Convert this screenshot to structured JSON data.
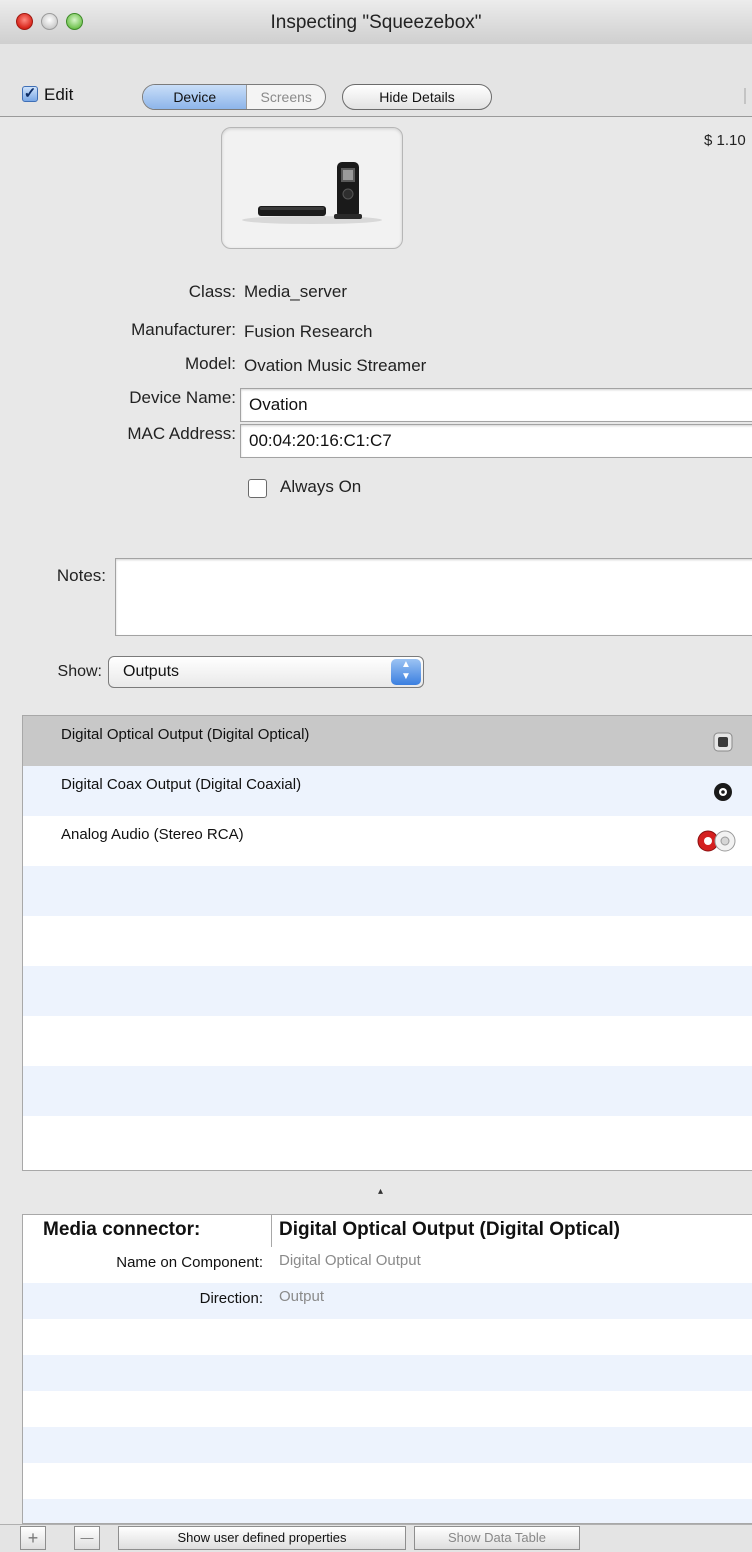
{
  "window": {
    "title": "Inspecting \"Squeezebox\""
  },
  "toolbar": {
    "edit_label": "Edit",
    "edit_checked": true,
    "segments": [
      "Device",
      "Screens"
    ],
    "selected_segment": "Device",
    "hide_details_label": "Hide Details"
  },
  "price": "$ 1.10",
  "device": {
    "class_label": "Class:",
    "class_value": "Media_server",
    "manufacturer_label": "Manufacturer:",
    "manufacturer_value": "Fusion Research",
    "model_label": "Model:",
    "model_value": "Ovation Music Streamer",
    "device_name_label": "Device Name:",
    "device_name_value": "Ovation",
    "mac_label": "MAC Address:",
    "mac_value": "00:04:20:16:C1:C7",
    "always_on_label": "Always On",
    "always_on_checked": false,
    "notes_label": "Notes:",
    "notes_value": ""
  },
  "show": {
    "label": "Show:",
    "selected": "Outputs"
  },
  "outputs": [
    {
      "label": "Digital Optical Output (Digital Optical)",
      "connector": "optical-connector-icon",
      "selected": true
    },
    {
      "label": "Digital Coax Output (Digital Coaxial)",
      "connector": "coax-connector-icon",
      "selected": false
    },
    {
      "label": "Analog Audio (Stereo RCA)",
      "connector": "rca-stereo-connector-icon",
      "selected": false
    }
  ],
  "properties": {
    "header_label": "Media connector:",
    "header_value": "Digital Optical Output (Digital Optical)",
    "rows": [
      {
        "label": "Name on Component:",
        "value": "Digital Optical Output"
      },
      {
        "label": "Direction:",
        "value": "Output"
      }
    ]
  },
  "bottom": {
    "add_glyph": "+",
    "remove_glyph": "—",
    "show_user_props_label": "Show user defined properties",
    "show_data_table_label": "Show Data Table"
  },
  "colors": {
    "selected_row": "#c8c8c8",
    "stripe": "#edf3fd",
    "accent": "#3b7fe0",
    "rca_red": "#d42020"
  }
}
